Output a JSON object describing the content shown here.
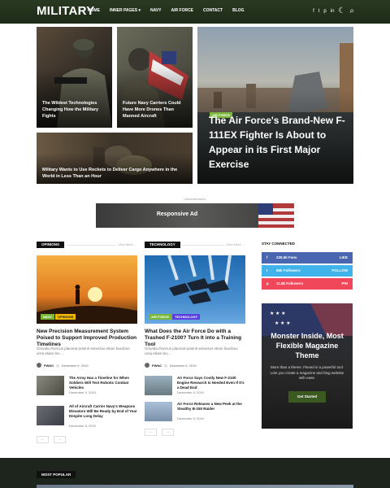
{
  "nav": {
    "logo": "MILITARY",
    "items": [
      "HOME",
      "INNER PAGES ▾",
      "NAVY",
      "AIR FORCE",
      "CONTACT",
      "BLOG"
    ],
    "icons": [
      "f",
      "t",
      "p",
      "in",
      "☾",
      "⌕"
    ]
  },
  "featured": [
    {
      "title": "The Wildest Technologies Changing How the Military Fights"
    },
    {
      "title": "Future Navy Carriers Could Have More Drones Than Manned Aircraft"
    },
    {
      "title": "Military Wants to Use Rockets to Deliver Cargo Anywhere in the World in Less Than an Hour"
    }
  ],
  "hero": {
    "badge": "AIR FORCE",
    "title": "The Air Force's Brand-New F-111EX Fighter Is About to Appear in its First Major Exercise"
  },
  "ad": {
    "label": "- Advertisement -",
    "text": "Responsive Ad"
  },
  "opinions": {
    "header": "OPINIONS",
    "more": "View More →",
    "main": {
      "badges": [
        "NAVY",
        "OPINIONS"
      ],
      "title": "New Precision Measurement System Poised to Support Improved Production Timelines",
      "excerpt": "Gravida rhoncus placerat potenti senectus etiam faucibus urna etiam leo ...",
      "author": "PWNC",
      "date": "December 9, 2019"
    },
    "list": [
      {
        "title": "The Army Has a Timeline for When Soldiers Will Test Robotic Combat Vehicles",
        "date": "December 9, 2019"
      },
      {
        "title": "All of Aircraft Carrier Navy's Weapons Elevators Will Be Ready by End of Year Despite Long Delay",
        "date": "December 9, 2019"
      }
    ]
  },
  "technology": {
    "header": "TECHNOLOGY",
    "more": "View More →",
    "main": {
      "badges": [
        "AIR FORCE",
        "TECHNOLOGY"
      ],
      "title": "What Does the Air Force Do with a Trashed F-2100? Turn It into a Training Tool",
      "excerpt": "Gravida rhoncus placerat potenti senectus etiam faucibus urna etiam leo ...",
      "author": "PWNC",
      "date": "December 9, 2019"
    },
    "list": [
      {
        "title": "Air Force Says Costly New F-2100 Engine Research Is Needed Even If It's a Dead End",
        "date": "December 9, 2019"
      },
      {
        "title": "Air Force Releases a New Peek at the Stealthy B-150 Raider",
        "date": "December 9, 2019"
      }
    ]
  },
  "stay": {
    "header": "STAY CONNECTED",
    "items": [
      {
        "count": "235.5k Fans",
        "action": "LIKE",
        "color": "#4a66b0"
      },
      {
        "count": "65k Followers",
        "action": "FOLLOW",
        "color": "#3fb3ea"
      },
      {
        "count": "11.8k Followers",
        "action": "PIN",
        "color": "#f0485a"
      }
    ]
  },
  "promo": {
    "title": "Monster Inside, Most Flexible Magazine Theme",
    "text": "More than a theme. Flexed is a powerful tool. Lets you create a magazine and blog website with ease.",
    "button": "Get Started"
  },
  "footer": {
    "header": "MOST POPULAR"
  },
  "pager": {
    "prev": "←",
    "next": "→"
  }
}
